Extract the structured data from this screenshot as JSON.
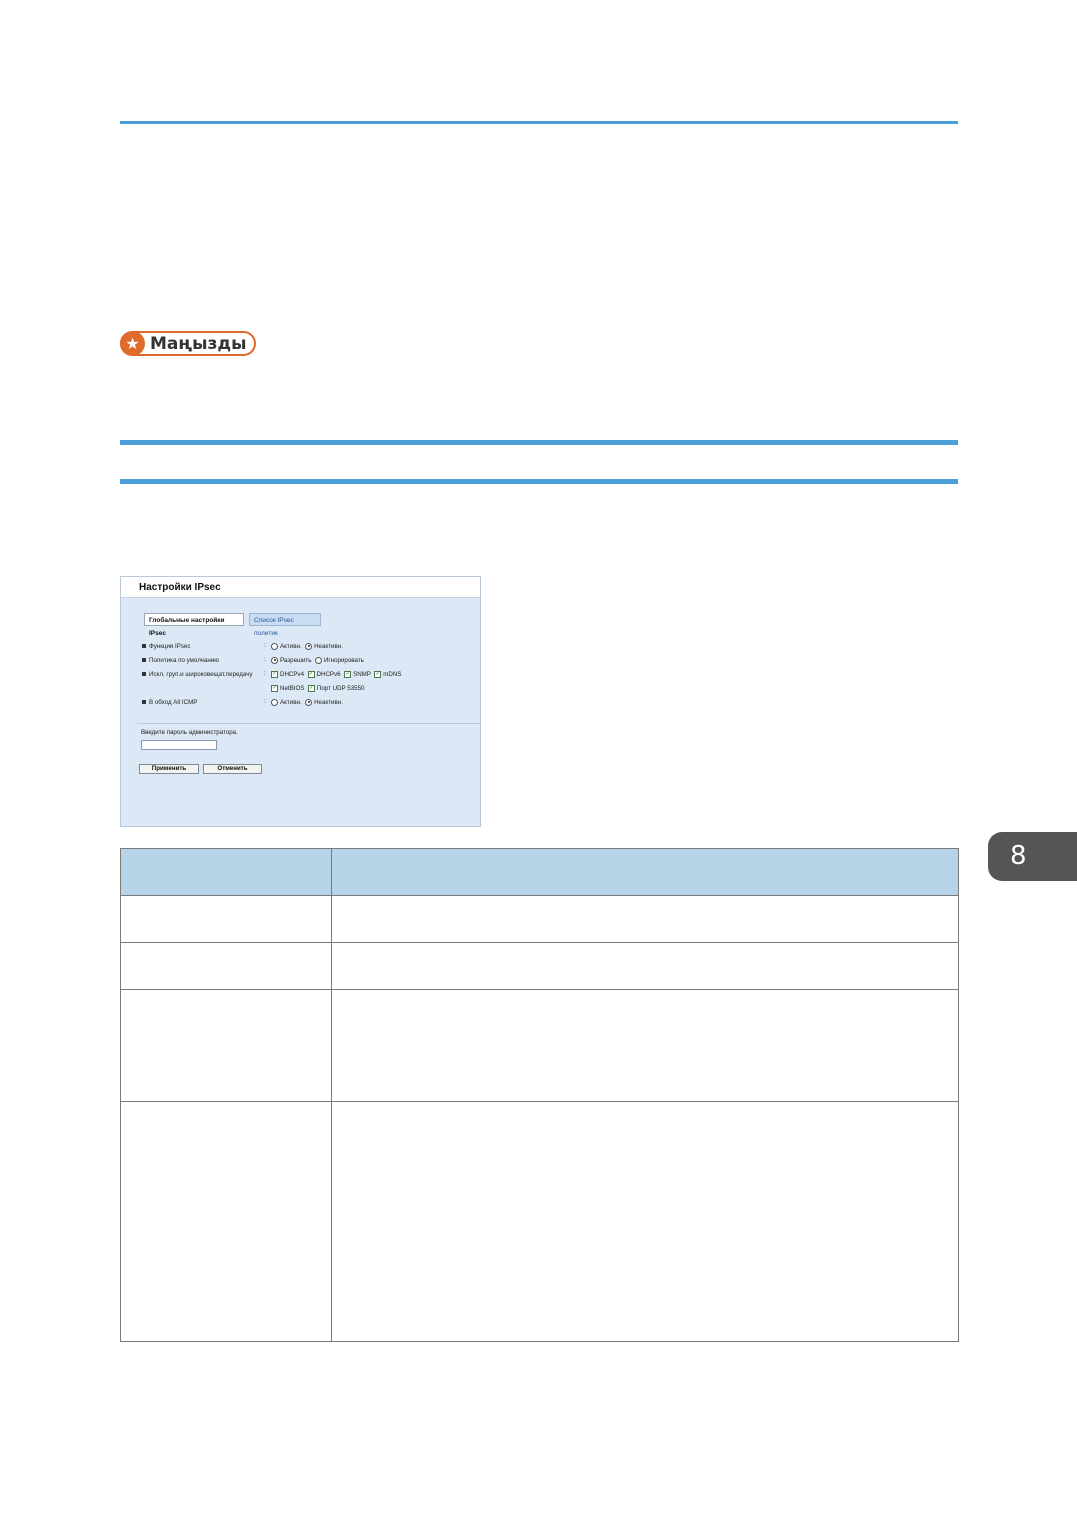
{
  "important_badge": {
    "label": "Маңызды"
  },
  "screenshot": {
    "title": "Настройки IPsec",
    "tabs": [
      {
        "label": "Глобальные настройки IPsec",
        "active": true
      },
      {
        "label": "Список IPsec политик",
        "active": false
      }
    ],
    "settings": [
      {
        "label": "Функция IPsec",
        "options": [
          {
            "label": "Активн.",
            "selected": false
          },
          {
            "label": "Неактивн.",
            "selected": true
          }
        ]
      },
      {
        "label": "Политика по умолчанию",
        "options": [
          {
            "label": "Разрешить",
            "selected": true
          },
          {
            "label": "Игнорировать",
            "selected": false
          }
        ]
      },
      {
        "label": "Искл. груп.и широковещат.передачу",
        "checkboxes_line1": [
          "DHCPv4",
          "DHCPv6",
          "SNMP",
          "mDNS"
        ],
        "checkboxes_line2": [
          "NetBIOS",
          "Порт UDP 53550"
        ]
      },
      {
        "label": "В обход All ICMP",
        "options": [
          {
            "label": "Активн.",
            "selected": false
          },
          {
            "label": "Неактивн.",
            "selected": true
          }
        ]
      }
    ],
    "password_label": "Введите пароль администратора.",
    "password_value": "",
    "apply_button": "Применить",
    "cancel_button": "Отменить"
  },
  "table": {
    "headers": [
      "",
      ""
    ],
    "rows": [
      [
        "",
        ""
      ],
      [
        "",
        ""
      ],
      [
        "",
        ""
      ],
      [
        "",
        ""
      ]
    ]
  },
  "chapter_tab": {
    "number": "8"
  }
}
